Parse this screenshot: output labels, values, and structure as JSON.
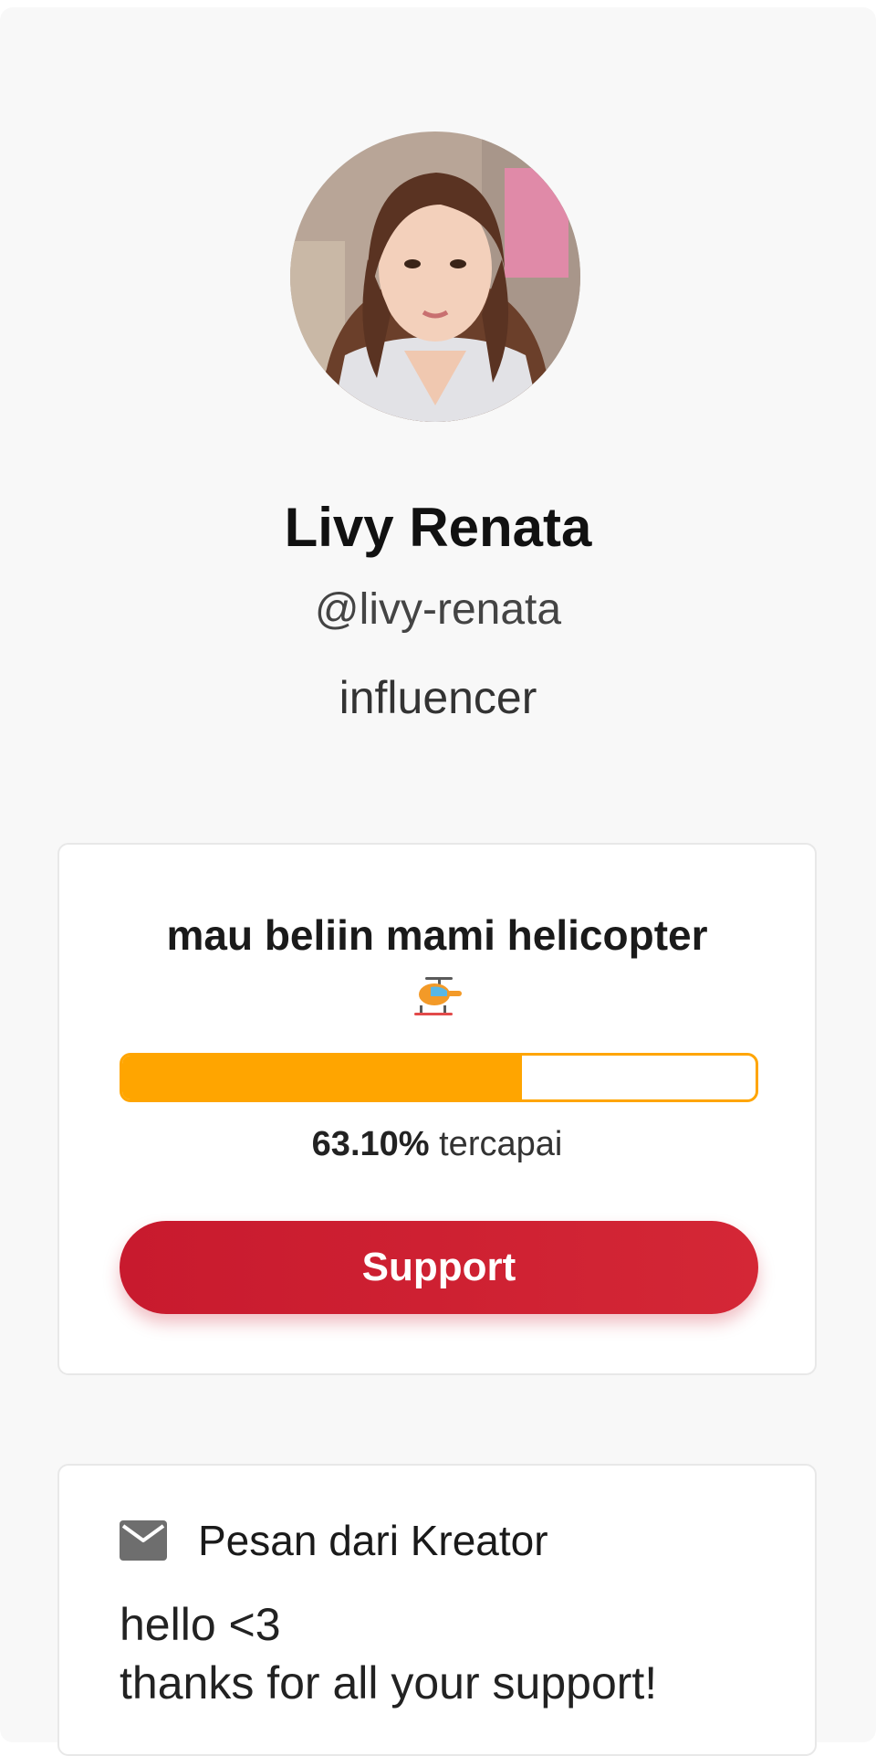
{
  "profile": {
    "name": "Livy Renata",
    "handle": "@livy-renata",
    "bio": "influencer"
  },
  "goal": {
    "title": "mau beliin mami helicopter",
    "icon": "helicopter-icon",
    "progress_percent": 63.1,
    "progress_value_text": "63.10%",
    "progress_suffix": "tercapai",
    "support_label": "Support"
  },
  "message": {
    "icon": "mail-icon",
    "title": "Pesan dari Kreator",
    "lines": [
      "hello <3",
      "thanks for all your support!"
    ]
  },
  "colors": {
    "accent_orange": "#ffa500",
    "support_red": "#d0202f",
    "background": "#f8f8f8"
  }
}
